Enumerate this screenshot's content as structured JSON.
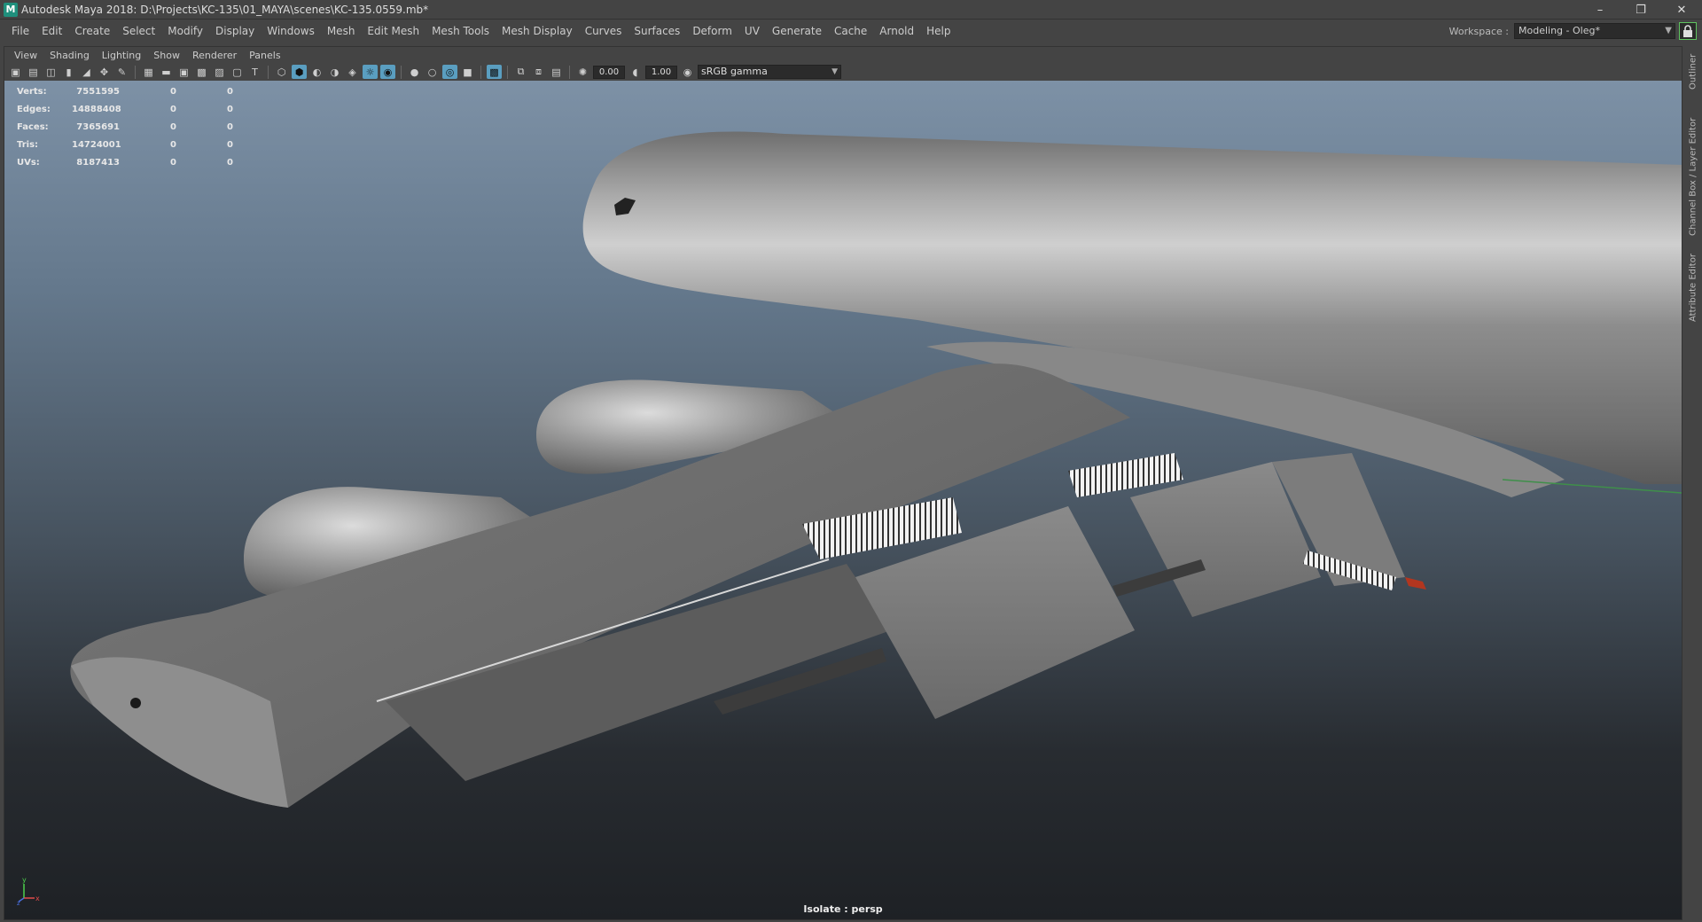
{
  "window": {
    "app_icon": "M",
    "title": "Autodesk Maya 2018: D:\\Projects\\KC-135\\01_MAYA\\scenes\\KC-135.0559.mb*",
    "controls": {
      "minimize": "–",
      "restore": "❐",
      "close": "✕"
    }
  },
  "menubar": {
    "items": [
      "File",
      "Edit",
      "Create",
      "Select",
      "Modify",
      "Display",
      "Windows",
      "Mesh",
      "Edit Mesh",
      "Mesh Tools",
      "Mesh Display",
      "Curves",
      "Surfaces",
      "Deform",
      "UV",
      "Generate",
      "Cache",
      "Arnold",
      "Help"
    ]
  },
  "workspace": {
    "label": "Workspace :",
    "value": "Modeling - Oleg*",
    "lock_icon": "lock-icon"
  },
  "panel": {
    "menu": [
      "View",
      "Shading",
      "Lighting",
      "Show",
      "Renderer",
      "Panels"
    ],
    "toolbar": {
      "exposure": "0.00",
      "gamma": "1.00",
      "color_space": "sRGB gamma"
    }
  },
  "hud": {
    "rows": [
      {
        "label": "Verts:",
        "v1": "7551595",
        "v2": "0",
        "v3": "0"
      },
      {
        "label": "Edges:",
        "v1": "14888408",
        "v2": "0",
        "v3": "0"
      },
      {
        "label": "Faces:",
        "v1": "7365691",
        "v2": "0",
        "v3": "0"
      },
      {
        "label": "Tris:",
        "v1": "14724001",
        "v2": "0",
        "v3": "0"
      },
      {
        "label": "UVs:",
        "v1": "8187413",
        "v2": "0",
        "v3": "0"
      }
    ]
  },
  "viewport": {
    "status": "Isolate : persp",
    "axis": {
      "y": "y",
      "x": "x",
      "z": "z"
    }
  },
  "sidetabs": [
    "Outliner",
    "Channel Box / Layer Editor",
    "Attribute Editor"
  ],
  "colors": {
    "accent_active": "#5a9ec0",
    "lock_green": "#5fc35f",
    "app_icon": "#1f8f7c"
  }
}
